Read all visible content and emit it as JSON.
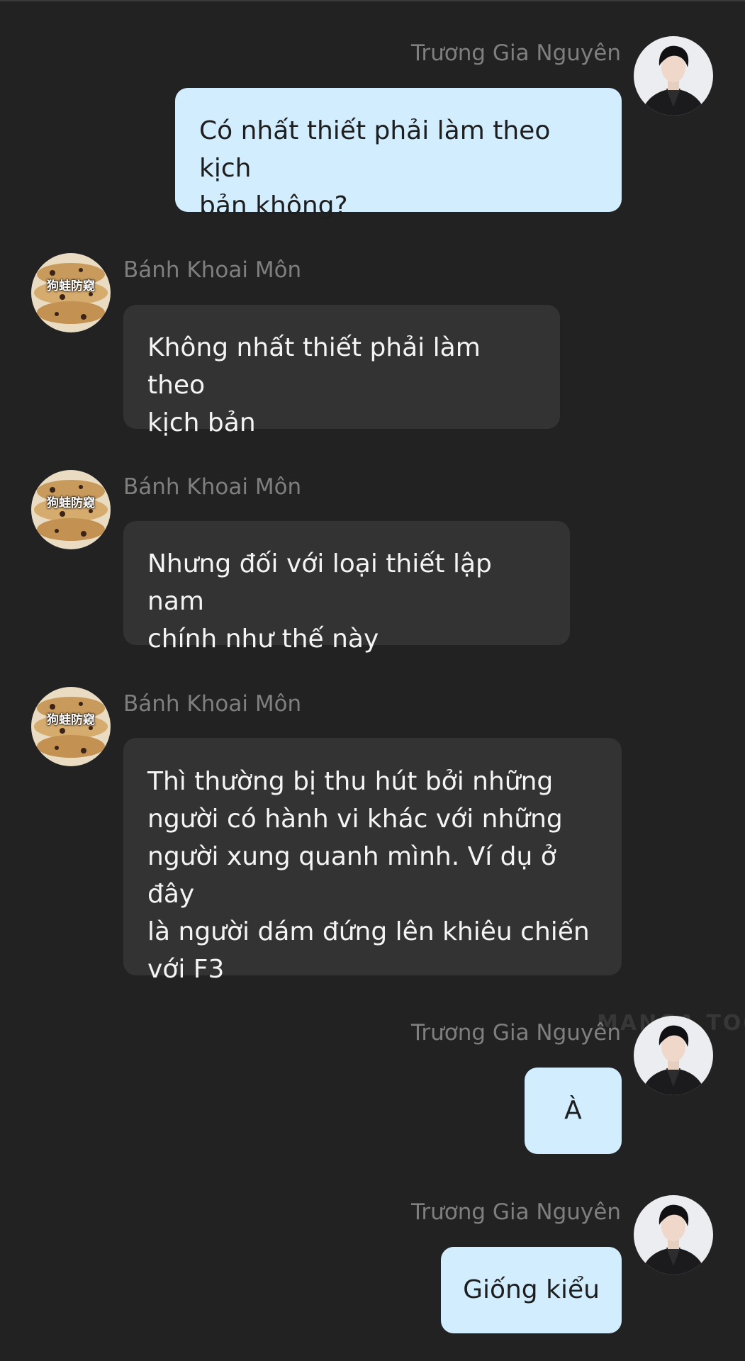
{
  "messages": [
    {
      "sender": "Trương Gia Nguyên",
      "direction": "outgoing",
      "avatar": "man-dark-suit-avatar",
      "lines": [
        "Có nhất thiết phải làm theo kịch",
        "bản không?"
      ]
    },
    {
      "sender": "Bánh Khoai Môn",
      "direction": "incoming",
      "avatar": "baked-goods-avatar",
      "avatar_caption": "狗蛙防窥",
      "lines": [
        "Không nhất thiết phải làm theo",
        "kịch bản"
      ]
    },
    {
      "sender": "Bánh Khoai Môn",
      "direction": "incoming",
      "avatar": "baked-goods-avatar",
      "avatar_caption": "狗蛙防窥",
      "lines": [
        "Nhưng đối với loại thiết lập nam",
        "chính như thế này"
      ]
    },
    {
      "sender": "Bánh Khoai Môn",
      "direction": "incoming",
      "avatar": "baked-goods-avatar",
      "avatar_caption": "狗蛙防窥",
      "lines": [
        "Thì thường bị thu hút bởi những",
        "người có hành vi khác với những",
        "người xung quanh mình. Ví dụ ở đây",
        "là người dám đứng lên khiêu chiến",
        "với F3"
      ]
    },
    {
      "sender": "Trương Gia Nguyên",
      "direction": "outgoing",
      "avatar": "man-dark-suit-avatar",
      "lines": [
        "À"
      ]
    },
    {
      "sender": "Trương Gia Nguyên",
      "direction": "outgoing",
      "avatar": "man-dark-suit-avatar",
      "lines": [
        "Giống kiểu"
      ]
    }
  ],
  "watermark": "MANGA TOON",
  "colors": {
    "background": "#222223",
    "outgoing_bubble": "#d2edfe",
    "incoming_bubble": "#333334",
    "sender_name": "#7f7f80"
  }
}
